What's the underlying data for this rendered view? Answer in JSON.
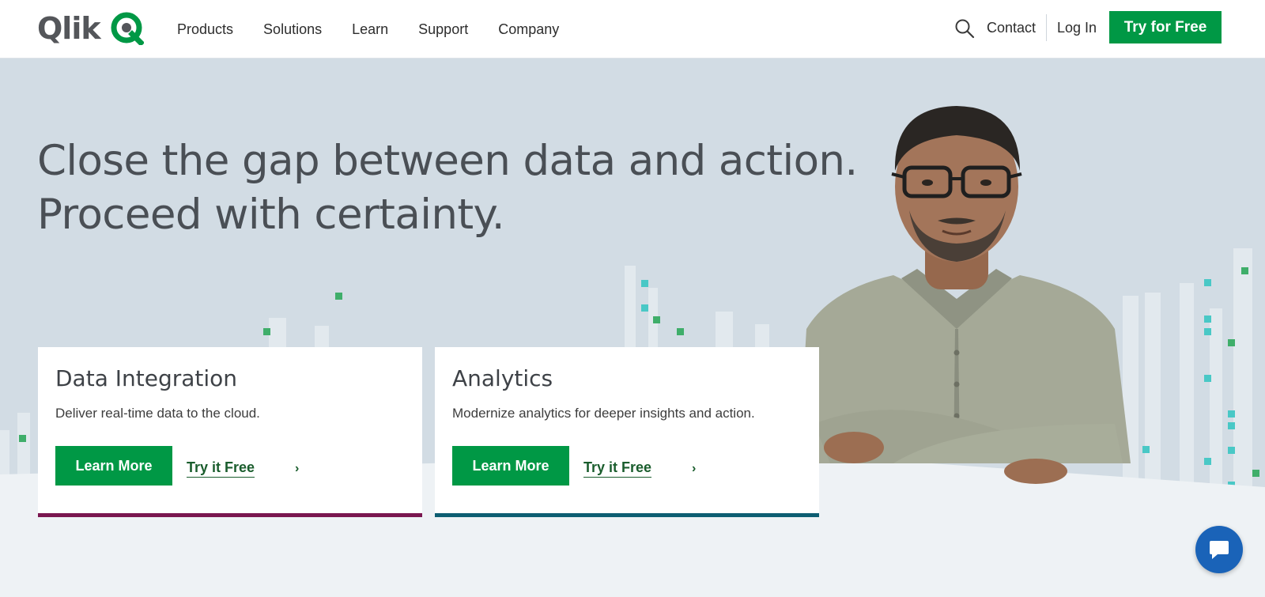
{
  "brand": {
    "logo_text": "Qlik",
    "accent": "#009845",
    "logo_icon": "qlik-q-icon"
  },
  "nav": {
    "items": [
      "Products",
      "Solutions",
      "Learn",
      "Support",
      "Company"
    ],
    "search_icon": "search-icon",
    "contact_label": "Contact",
    "login_label": "Log In",
    "cta_label": "Try for Free"
  },
  "hero": {
    "headline_line1": "Close the gap between data and action.",
    "headline_line2": "Proceed with certainty."
  },
  "cards": [
    {
      "title": "Data Integration",
      "description": "Deliver real-time data to the cloud.",
      "button_label": "Learn More",
      "link_label": "Try it Free",
      "bar_color": "#7a1750"
    },
    {
      "title": "Analytics",
      "description": "Modernize analytics for deeper insights and action.",
      "button_label": "Learn More",
      "link_label": "Try it Free",
      "bar_color": "#0e5e72"
    }
  ],
  "chat": {
    "icon": "chat-bubble-icon",
    "color": "#1a63b8"
  }
}
